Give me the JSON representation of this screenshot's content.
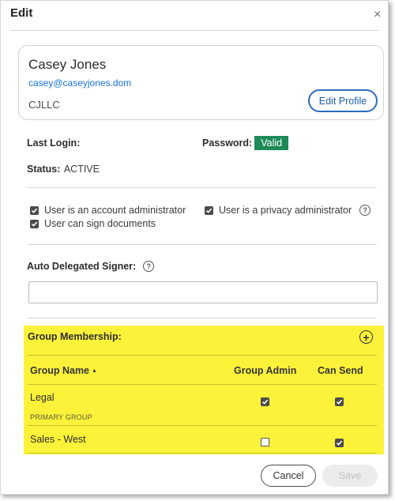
{
  "dialog": {
    "title": "Edit",
    "close_glyph": "×"
  },
  "profile": {
    "name": "Casey Jones",
    "email": "casey@caseyjones.dom",
    "company": "CJLLC",
    "edit_label": "Edit Profile"
  },
  "login": {
    "label": "Last Login:",
    "value": ""
  },
  "password": {
    "label": "Password:",
    "badge": "Valid"
  },
  "status": {
    "label": "Status:",
    "value": "ACTIVE"
  },
  "permissions": {
    "account_admin": {
      "label": "User is an account administrator",
      "checked": true
    },
    "sign_documents": {
      "label": "User can sign documents",
      "checked": true
    },
    "privacy_admin": {
      "label": "User is a privacy administrator",
      "checked": true
    }
  },
  "delegated": {
    "label": "Auto Delegated Signer:",
    "value": "",
    "help_glyph": "?"
  },
  "groups": {
    "title": "Group Membership:",
    "add_glyph": "+",
    "columns": {
      "name": "Group Name",
      "sort_glyph": "▲",
      "admin": "Group Admin",
      "send": "Can Send"
    },
    "rows": [
      {
        "name": "Legal",
        "sub": "PRIMARY GROUP",
        "admin": true,
        "send": true
      },
      {
        "name": "Sales - West",
        "admin": false,
        "send": true
      }
    ]
  },
  "footer": {
    "cancel": "Cancel",
    "save": "Save"
  },
  "colors": {
    "accent": "#1473e6",
    "valid": "#1e8a5a",
    "highlight": "#fdf23a"
  }
}
